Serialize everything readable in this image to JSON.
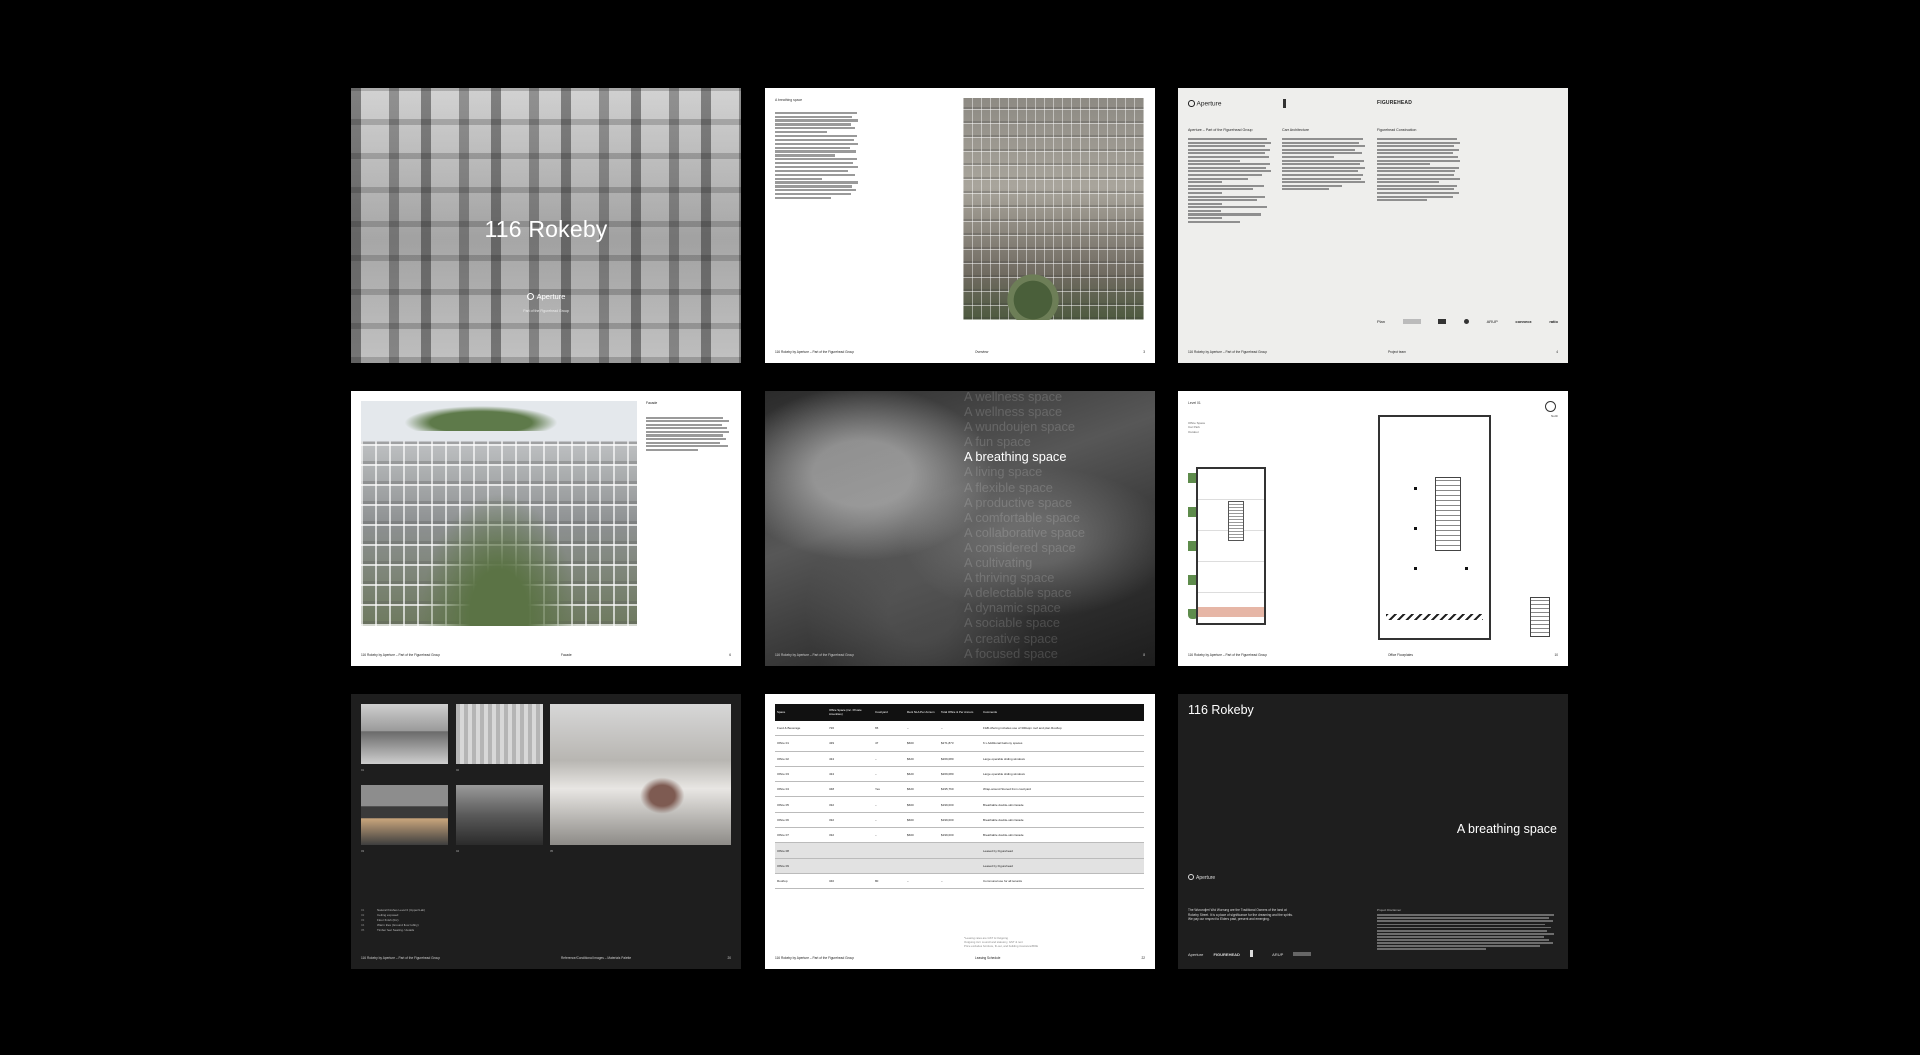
{
  "pages": {
    "cover": {
      "title": "116 Rokeby",
      "brand": "Aperture",
      "sub": "Part of the Figurehead Group"
    },
    "overview": {
      "heading": "A breathing space",
      "footer_left": "116 Rokeby by Aperture – Part of the Figurehead Group",
      "footer_mid": "Overview",
      "footer_page": "3"
    },
    "team": {
      "logo": "Aperture",
      "brand3": "FIGUREHEAD",
      "col1_title": "Aperture – Part of the Figurehead Group",
      "col2_title": "Carr Architecture",
      "col3_title": "Figurehead Construction",
      "partners": [
        "Plan",
        "ARUP",
        "connecx",
        "ratio"
      ],
      "footer_left": "116 Rokeby by Aperture – Part of the Figurehead Group",
      "footer_mid": "Project team",
      "footer_page": "4"
    },
    "facade": {
      "title": "Facade",
      "footer_left": "116 Rokeby by Aperture – Part of the Figurehead Group",
      "footer_mid": "Facade",
      "footer_page": "6"
    },
    "breathing": {
      "words": [
        "A wellness space",
        "A wellness space",
        "A wundoujen space",
        "A fun space",
        "A breathing space",
        "A living space",
        "A flexible space",
        "A productive space",
        "A comfortable space",
        "A collaborative space",
        "A considered space",
        "A cultivating",
        "A thriving space",
        "A delectable space",
        "A dynamic space",
        "A sociable space",
        "A creative space",
        "A focused space"
      ],
      "highlight_index": 4,
      "footer_left": "116 Rokeby by Aperture – Part of the Figurehead Group",
      "footer_page": "8"
    },
    "floorplan": {
      "level": "Level 01",
      "meta": [
        "Office Space",
        "Car Park",
        "Outdoor"
      ],
      "north": "North",
      "footer_left": "116 Rokeby by Aperture – Part of the Figurehead Group",
      "footer_mid": "Office Floorplates",
      "footer_page": "10"
    },
    "materials": {
      "thumb_nums": [
        "01",
        "02",
        "03",
        "04",
        "05"
      ],
      "legend": [
        {
          "n": "01",
          "t": "Natural finishes Level 0 (Upper/Lab)"
        },
        {
          "n": "02",
          "t": "Ceiling exposed"
        },
        {
          "n": "03",
          "t": "Floor finish (tbc)"
        },
        {
          "n": "04",
          "t": "Warm tiles (Ground floor lobby)"
        },
        {
          "n": "05",
          "t": "Timber feel Seating / details"
        }
      ],
      "footer_left": "116 Rokeby by Aperture – Part of the Figurehead Group",
      "footer_mid": "Reference/Conditional Images – Materials Palette",
      "footer_page": "20"
    },
    "leasing": {
      "headers": [
        "Space",
        "Office Space (inc. Private Amenities)",
        "Courtyard",
        "Rent NLA Per Annum",
        "Total Office & Per Annum",
        "Comments"
      ],
      "rows": [
        {
          "cells": [
            "Food & Beverage",
            "726",
            "65",
            "–",
            "–",
            "F&B offering includes use of 300sqm roof and plan Rooftop"
          ],
          "leased": false
        },
        {
          "cells": [
            "Office 01",
            "439",
            "47",
            "$600",
            "$271,873",
            "6 x Additional balcony spaces"
          ],
          "leased": false
        },
        {
          "cells": [
            "Office 02",
            "434",
            "–",
            "$620",
            "$269,080",
            "Large operable sliding windows"
          ],
          "leased": false
        },
        {
          "cells": [
            "Office 03",
            "434",
            "–",
            "$620",
            "$269,080",
            "Large operable sliding windows"
          ],
          "leased": false
        },
        {
          "cells": [
            "Office 04",
            "348",
            "Yes",
            "$620",
            "$195,760",
            "Wrap-around Stoned from courtyard"
          ],
          "leased": false
        },
        {
          "cells": [
            "Office 05",
            "332",
            "–",
            "$600",
            "$199,000",
            "Breathable double-skin facade"
          ],
          "leased": false
        },
        {
          "cells": [
            "Office 06",
            "332",
            "–",
            "$600",
            "$199,000",
            "Breathable double-skin facade"
          ],
          "leased": false
        },
        {
          "cells": [
            "Office 07",
            "332",
            "–",
            "$600",
            "$199,000",
            "Breathable double-skin facade"
          ],
          "leased": false
        },
        {
          "cells": [
            "Office 08",
            "",
            "",
            "",
            "",
            "Leased by Figurehead"
          ],
          "leased": true
        },
        {
          "cells": [
            "Office 09",
            "",
            "",
            "",
            "",
            "Leased by Figurehead"
          ],
          "leased": true
        },
        {
          "cells": [
            "Rooftop",
            "340",
            "80",
            "–",
            "–",
            "Communal use for all tenants"
          ],
          "leased": false
        }
      ],
      "notes": [
        "*Leasing rates are GST & Outgoing",
        "Outgoing incl. council and statutory, GST & rent",
        "Price excludes furniture, fit-out, and building insurance/BOE"
      ],
      "footer_left": "116 Rokeby by Aperture – Part of the Figurehead Group",
      "footer_mid": "Leasing Schedule",
      "footer_page": "22"
    },
    "closing": {
      "title": "116 Rokeby",
      "tagline": "A breathing space",
      "brand": "Aperture",
      "ack": "The Wurundjeri Woi Wurrung are the Traditional Owners of the land at Rokeby Street. It is a place of significance for the dreaming and the spirits. We pay our respect to Elders past, present and emerging.",
      "disclaimer_title": "Project Disclaimer",
      "logos": [
        "Aperture",
        "FIGUREHEAD",
        "ARUP"
      ]
    }
  }
}
